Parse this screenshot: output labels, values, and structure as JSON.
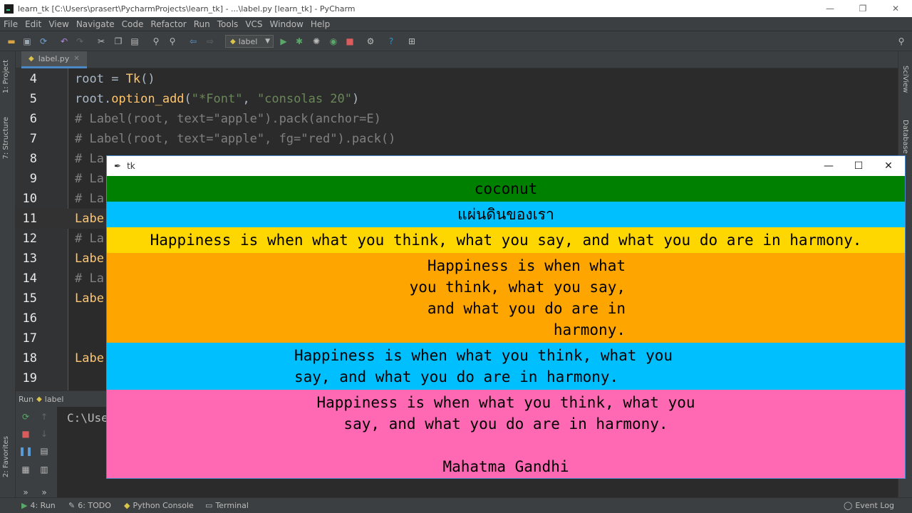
{
  "window": {
    "title": "learn_tk [C:\\Users\\prasert\\PycharmProjects\\learn_tk] - ...\\label.py [learn_tk] - PyCharm",
    "controls": [
      "—",
      "❐",
      "✕"
    ]
  },
  "menu": [
    "File",
    "Edit",
    "View",
    "Navigate",
    "Code",
    "Refactor",
    "Run",
    "Tools",
    "VCS",
    "Window",
    "Help"
  ],
  "toolbar": {
    "run_config": "label",
    "icons": [
      "open-icon",
      "save-icon",
      "sync-icon",
      "undo-icon",
      "redo-icon",
      "cut-icon",
      "copy-icon",
      "paste-icon",
      "find-icon",
      "replace-icon",
      "back-icon",
      "forward-icon",
      "run-icon",
      "debug-icon",
      "coverage-icon",
      "profile-icon",
      "stop-icon",
      "settings-icon",
      "help-icon",
      "sdk-icon",
      "search-icon"
    ]
  },
  "left_tabs": [
    "1: Project",
    "7: Structure",
    "2: Favorites"
  ],
  "right_tabs": [
    "SciView",
    "Database"
  ],
  "editor": {
    "file_tab": "label.py",
    "lines": [
      {
        "n": "4",
        "parts": [
          [
            "kw",
            "root "
          ],
          [
            "par",
            "= "
          ],
          [
            "fn",
            "Tk"
          ],
          [
            "par",
            "()"
          ]
        ]
      },
      {
        "n": "5",
        "parts": [
          [
            "kw",
            "root."
          ],
          [
            "fn",
            "option_add"
          ],
          [
            "par",
            "("
          ],
          [
            "str",
            "\"*Font\""
          ],
          [
            "par",
            ", "
          ],
          [
            "str",
            "\"consolas 20\""
          ],
          [
            "par",
            ")"
          ]
        ]
      },
      {
        "n": "6",
        "parts": [
          [
            "cm",
            "# Label(root, text=\"apple\").pack(anchor=E)"
          ]
        ]
      },
      {
        "n": "7",
        "parts": [
          [
            "cm",
            "# Label(root, text=\"apple\", fg=\"red\").pack()"
          ]
        ]
      },
      {
        "n": "8",
        "parts": [
          [
            "cm",
            "# La"
          ]
        ]
      },
      {
        "n": "9",
        "parts": [
          [
            "cm",
            "# La"
          ]
        ]
      },
      {
        "n": "10",
        "parts": [
          [
            "cm",
            "# La"
          ]
        ]
      },
      {
        "n": "11",
        "parts": [
          [
            "fn",
            "Labe"
          ]
        ]
      },
      {
        "n": "12",
        "parts": [
          [
            "cm",
            "# La"
          ]
        ]
      },
      {
        "n": "13",
        "parts": [
          [
            "fn",
            "Labe"
          ]
        ]
      },
      {
        "n": "14",
        "parts": [
          [
            "cm",
            "# La"
          ]
        ]
      },
      {
        "n": "15",
        "parts": [
          [
            "fn",
            "Labe"
          ]
        ]
      },
      {
        "n": "16",
        "parts": [
          [
            "cm",
            ""
          ]
        ]
      },
      {
        "n": "17",
        "parts": [
          [
            "cm",
            ""
          ]
        ]
      },
      {
        "n": "18",
        "parts": [
          [
            "fn",
            "Labe"
          ]
        ]
      },
      {
        "n": "19",
        "parts": [
          [
            "cm",
            ""
          ]
        ]
      }
    ]
  },
  "run_panel": {
    "label": "Run",
    "config": "label",
    "console_text": "C:\\Use"
  },
  "statusbar": {
    "run": "4: Run",
    "todo": "6: TODO",
    "python_console": "Python Console",
    "terminal": "Terminal",
    "event_log": "Event Log"
  },
  "tk": {
    "title": "tk",
    "controls": [
      "—",
      "☐",
      "✕"
    ],
    "labels": [
      {
        "bg": "#008000",
        "lines": [
          "coconut"
        ]
      },
      {
        "bg": "#00bfff",
        "lines": [
          "แผ่นดินของเรา"
        ]
      },
      {
        "bg": "#ffd700",
        "lines": [
          "Happiness is when what you think, what you say, and what you do are in harmony."
        ]
      },
      {
        "bg": "#ffa500",
        "lines": [
          "Happiness is when what",
          "you think, what you say,",
          "and what you do are in",
          "harmony."
        ]
      },
      {
        "bg": "#00bfff",
        "lines": [
          "Happiness is when what you think, what you",
          "say, and what you do are in harmony."
        ]
      },
      {
        "bg": "#ff69b4",
        "lines": [
          "Happiness is when what you think, what you",
          "say, and what you do are in harmony.",
          "",
          "Mahatma Gandhi"
        ]
      }
    ]
  }
}
